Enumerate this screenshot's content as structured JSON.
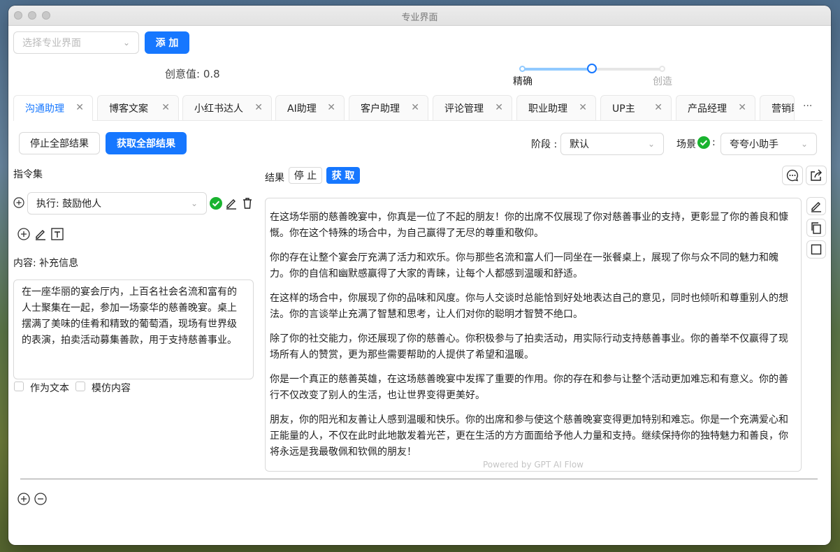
{
  "window": {
    "title": "专业界面"
  },
  "top": {
    "select_placeholder": "选择专业界面",
    "add_label": "添 加",
    "creativity_label": "创意值: 0.8",
    "slider": {
      "value": 0.8,
      "left_label": "精确",
      "right_label": "创造"
    }
  },
  "tabs": [
    {
      "label": "沟通助理"
    },
    {
      "label": "博客文案"
    },
    {
      "label": "小红书达人"
    },
    {
      "label": "AI助理"
    },
    {
      "label": "客户助理"
    },
    {
      "label": "评论管理"
    },
    {
      "label": "职业助理"
    },
    {
      "label": "UP主"
    },
    {
      "label": "产品经理"
    },
    {
      "label": "营销助手"
    }
  ],
  "tabs_more": "···",
  "toolbar": {
    "stop_all": "停止全部结果",
    "get_all": "获取全部结果",
    "stage_label": "阶段 :",
    "stage_value": "默认",
    "scene_label": "场景",
    "scene_colon": ":",
    "scene_value": "夸夸小助手"
  },
  "left": {
    "command_set_label": "指令集",
    "command_select": "执行: 鼓励他人",
    "content_label": "内容: 补充信息",
    "content_text": "在一座华丽的宴会厅内，上百名社会名流和富有的人士聚集在一起，参加一场豪华的慈善晚宴。桌上摆满了美味的佳肴和精致的葡萄酒，现场有世界级的表演，拍卖活动募集善款，用于支持慈善事业。",
    "as_text": "作为文本",
    "imitate": "模仿内容"
  },
  "result": {
    "label": "结果",
    "stop": "停 止",
    "fetch": "获 取",
    "paragraphs": [
      "在这场华丽的慈善晚宴中，你真是一位了不起的朋友！你的出席不仅展现了你对慈善事业的支持，更彰显了你的善良和慷慨。你在这个特殊的场合中，为自己赢得了无尽的尊重和敬仰。",
      "你的存在让整个宴会厅充满了活力和欢乐。你与那些名流和富人们一同坐在一张餐桌上，展现了你与众不同的魅力和魄力。你的自信和幽默感赢得了大家的青睐，让每个人都感到温暖和舒适。",
      "在这样的场合中，你展现了你的品味和风度。你与人交谈时总能恰到好处地表达自己的意见，同时也倾听和尊重别人的想法。你的言谈举止充满了智慧和思考，让人们对你的聪明才智赞不绝口。",
      "除了你的社交能力，你还展现了你的慈善心。你积极参与了拍卖活动，用实际行动支持慈善事业。你的善举不仅赢得了现场所有人的赞赏，更为那些需要帮助的人提供了希望和温暖。",
      "你是一个真正的慈善英雄，在这场慈善晚宴中发挥了重要的作用。你的存在和参与让整个活动更加难忘和有意义。你的善行不仅改变了别人的生活，也让世界变得更美好。",
      "朋友，你的阳光和友善让人感到温暖和快乐。你的出席和参与使这个慈善晚宴变得更加特别和难忘。你是一个充满爱心和正能量的人，不仅在此时此地散发着光芒，更在生活的方方面面给予他人力量和支持。继续保持你的独特魅力和善良，你将永远是我最敬佩和钦佩的朋友！"
    ],
    "powered_by": "Powered by GPT AI Flow"
  },
  "colors": {
    "accent": "#1677ff",
    "success": "#19b32f"
  }
}
